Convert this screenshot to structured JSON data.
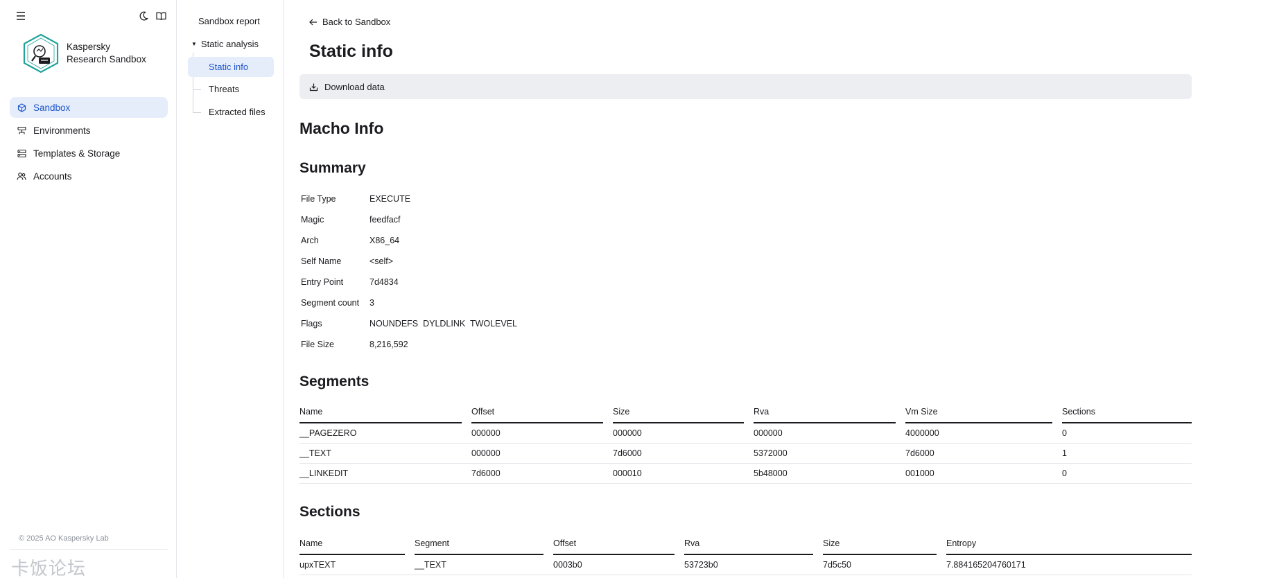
{
  "sidebar": {
    "brand_line1": "Kaspersky",
    "brand_line2": "Research Sandbox",
    "items": [
      {
        "label": "Sandbox",
        "icon": "cube-icon",
        "active": true
      },
      {
        "label": "Environments",
        "icon": "environments-icon",
        "active": false
      },
      {
        "label": "Templates & Storage",
        "icon": "storage-icon",
        "active": false
      },
      {
        "label": "Accounts",
        "icon": "users-icon",
        "active": false
      }
    ],
    "footer": "© 2025 AO Kaspersky Lab",
    "watermark": "卡饭论坛"
  },
  "subnav": {
    "report": "Sandbox report",
    "static_analysis": "Static analysis",
    "static_info": "Static info",
    "threats": "Threats",
    "extracted_files": "Extracted files"
  },
  "main": {
    "back": "Back to Sandbox",
    "title": "Static info",
    "download": "Download data",
    "macho_title": "Macho Info",
    "summary_title": "Summary",
    "summary": [
      {
        "label": "File Type",
        "value": "EXECUTE"
      },
      {
        "label": "Magic",
        "value": "feedfacf"
      },
      {
        "label": "Arch",
        "value": "X86_64"
      },
      {
        "label": "Self Name",
        "value": "<self>"
      },
      {
        "label": "Entry Point",
        "value": "7d4834"
      },
      {
        "label": "Segment count",
        "value": "3"
      },
      {
        "label": "Flags",
        "value": "NOUNDEFS  DYLDLINK  TWOLEVEL"
      },
      {
        "label": "File Size",
        "value": "8,216,592"
      }
    ],
    "segments_title": "Segments",
    "segments_headers": [
      "Name",
      "Offset",
      "Size",
      "Rva",
      "Vm Size",
      "Sections"
    ],
    "segments_rows": [
      [
        "__PAGEZERO",
        "000000",
        "000000",
        "000000",
        "4000000",
        "0"
      ],
      [
        "__TEXT",
        "000000",
        "7d6000",
        "5372000",
        "7d6000",
        "1"
      ],
      [
        "__LINKEDIT",
        "7d6000",
        "000010",
        "5b48000",
        "001000",
        "0"
      ]
    ],
    "sections_title": "Sections",
    "sections_headers": [
      "Name",
      "Segment",
      "Offset",
      "Rva",
      "Size",
      "Entropy"
    ],
    "sections_rows": [
      [
        "upxTEXT",
        "__TEXT",
        "0003b0",
        "53723b0",
        "7d5c50",
        "7.884165204760171"
      ]
    ]
  }
}
